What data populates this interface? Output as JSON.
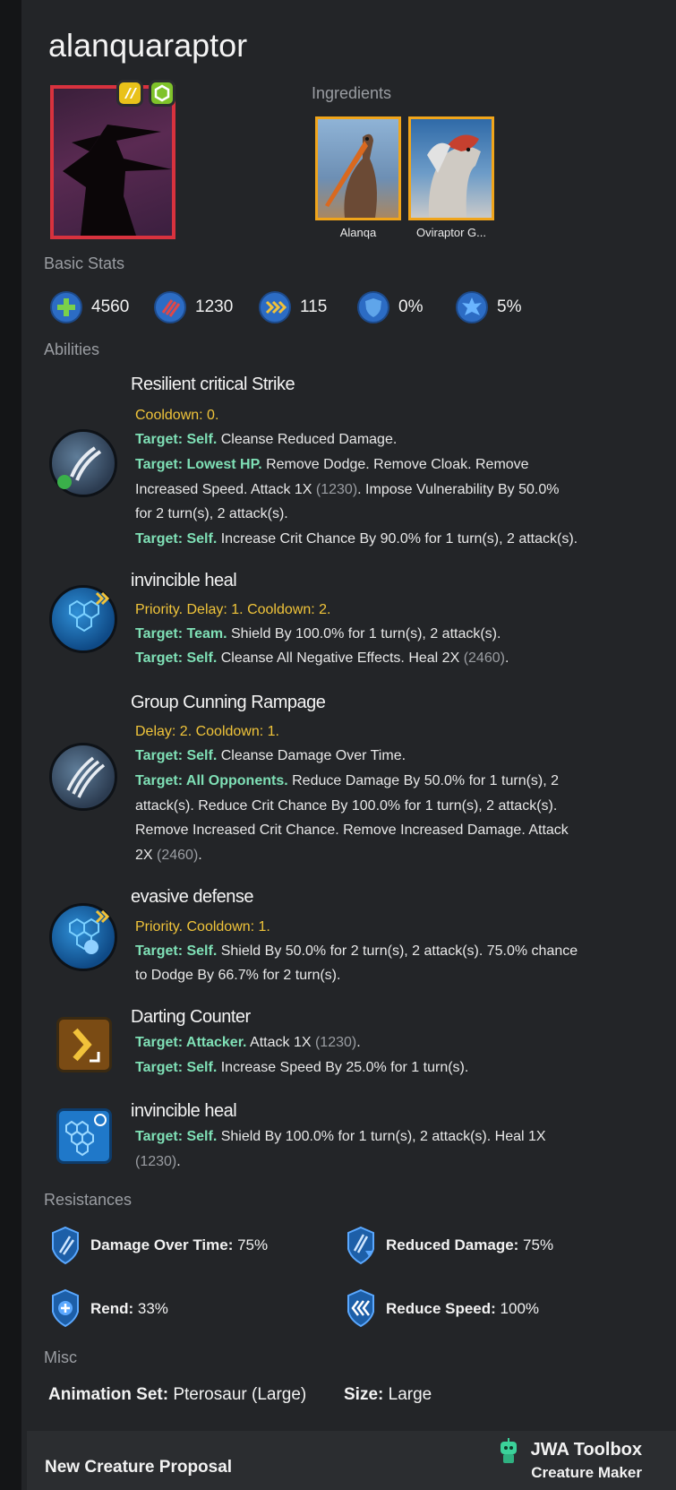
{
  "creature": {
    "name": "alanquaraptor",
    "rarity_color": "#d8323e"
  },
  "ingredients": {
    "label": "Ingredients",
    "items": [
      {
        "name": "Alanqa"
      },
      {
        "name": "Oviraptor G..."
      }
    ]
  },
  "basic_stats": {
    "label": "Basic Stats",
    "items": [
      {
        "icon": "health-icon",
        "value": "4560"
      },
      {
        "icon": "damage-icon",
        "value": "1230"
      },
      {
        "icon": "speed-icon",
        "value": "115"
      },
      {
        "icon": "armor-icon",
        "value": "0%"
      },
      {
        "icon": "crit-icon",
        "value": "5%"
      }
    ]
  },
  "abilities": {
    "label": "Abilities",
    "items": [
      {
        "name": "Resilient critical Strike",
        "header": "Cooldown: 0.",
        "lines": [
          {
            "target": "Target: Self.",
            "text": " Cleanse Reduced Damage."
          },
          {
            "target": "Target: Lowest HP.",
            "text": " Remove Dodge. Remove Cloak. Remove"
          },
          {
            "target": "",
            "text": "Increased Speed. Attack 1X ",
            "dim": "(1230)",
            "after": ". Impose Vulnerability By 50.0%"
          },
          {
            "target": "",
            "text": "for 2 turn(s), 2 attack(s)."
          },
          {
            "target": "Target: Self.",
            "text": " Increase Crit Chance By 90.0% for 1 turn(s), 2 attack(s)."
          }
        ]
      },
      {
        "name": "invincible heal",
        "header": "Priority. Delay: 1. Cooldown: 2.",
        "lines": [
          {
            "target": "Target: Team.",
            "text": " Shield By 100.0% for 1 turn(s), 2 attack(s)."
          },
          {
            "target": "Target: Self.",
            "text": " Cleanse All Negative Effects. Heal 2X ",
            "dim": "(2460)",
            "after": "."
          }
        ]
      },
      {
        "name": "Group Cunning Rampage",
        "header": "Delay: 2. Cooldown: 1.",
        "lines": [
          {
            "target": "Target: Self.",
            "text": " Cleanse Damage Over Time."
          },
          {
            "target": "Target: All Opponents.",
            "text": " Reduce Damage By 50.0% for 1 turn(s), 2"
          },
          {
            "target": "",
            "text": "attack(s). Reduce Crit Chance By 100.0% for 1 turn(s), 2 attack(s)."
          },
          {
            "target": "",
            "text": "Remove Increased Crit Chance. Remove Increased Damage. Attack"
          },
          {
            "target": "",
            "text": "2X ",
            "dim": "(2460)",
            "after": "."
          }
        ]
      },
      {
        "name": "evasive defense",
        "header": "Priority. Cooldown: 1.",
        "lines": [
          {
            "target": "Target: Self.",
            "text": " Shield By 50.0% for 2 turn(s), 2 attack(s). 75.0% chance"
          },
          {
            "target": "",
            "text": "to Dodge By 66.7% for 2 turn(s)."
          }
        ]
      },
      {
        "name": "Darting Counter",
        "header": "",
        "lines": [
          {
            "target": "Target: Attacker.",
            "text": " Attack 1X ",
            "dim": "(1230)",
            "after": "."
          },
          {
            "target": "Target: Self.",
            "text": " Increase Speed By 25.0% for 1 turn(s)."
          }
        ]
      },
      {
        "name": "invincible heal",
        "header": "",
        "lines": [
          {
            "target": "Target: Self.",
            "text": " Shield By 100.0% for 1 turn(s), 2 attack(s). Heal 1X"
          },
          {
            "target": "",
            "text": "",
            "dim": "(1230)",
            "after": "."
          }
        ]
      }
    ]
  },
  "resistances": {
    "label": "Resistances",
    "items": [
      {
        "icon": "damage-over-time-icon",
        "label": "Damage Over Time:",
        "value": " 75%"
      },
      {
        "icon": "reduced-damage-icon",
        "label": "Reduced Damage:",
        "value": " 75%"
      },
      {
        "icon": "rend-icon",
        "label": "Rend:",
        "value": " 33%"
      },
      {
        "icon": "reduce-speed-icon",
        "label": "Reduce Speed:",
        "value": " 100%"
      }
    ]
  },
  "misc": {
    "label": "Misc",
    "animation_label": "Animation Set:",
    "animation_value": " Pterosaur (Large)",
    "size_label": "Size:",
    "size_value": " Large"
  },
  "footer": {
    "left": "New Creature Proposal",
    "brand": "JWA Toolbox",
    "brand_sub": "Creature Maker"
  },
  "colors": {
    "target": "#7fe0b6",
    "cooldown": "#f0c43a",
    "ingredient_border": "#f0a51b"
  }
}
